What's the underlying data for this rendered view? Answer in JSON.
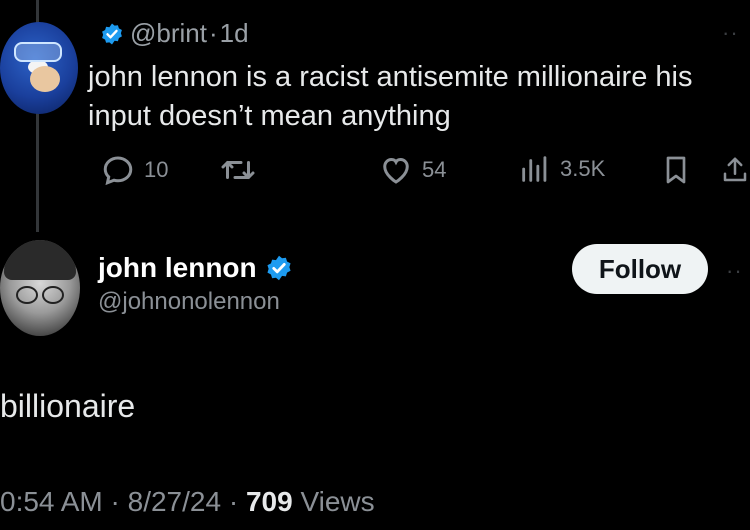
{
  "parent": {
    "handle": "@brint",
    "separator": "·",
    "time": "1d",
    "text": "john lennon  is a racist antisemite millionaire his input doesn’t mean anything",
    "actions": {
      "replies": "10",
      "retweets": "",
      "likes": "54",
      "views": "3.5K"
    }
  },
  "reply": {
    "name": "john lennon",
    "handle": "@johnonolennon",
    "follow_label": "Follow",
    "text": "billionaire",
    "time": "0:54 AM",
    "date": "8/27/24",
    "sep": "·",
    "views_count": "709",
    "views_label": "Views"
  },
  "colors": {
    "verified": "#1d9bf0",
    "background": "#000000",
    "muted": "#8b9096"
  },
  "icons": [
    "reply-icon",
    "retweet-icon",
    "like-icon",
    "views-icon",
    "bookmark-icon",
    "share-icon",
    "verified-icon",
    "more-icon"
  ]
}
